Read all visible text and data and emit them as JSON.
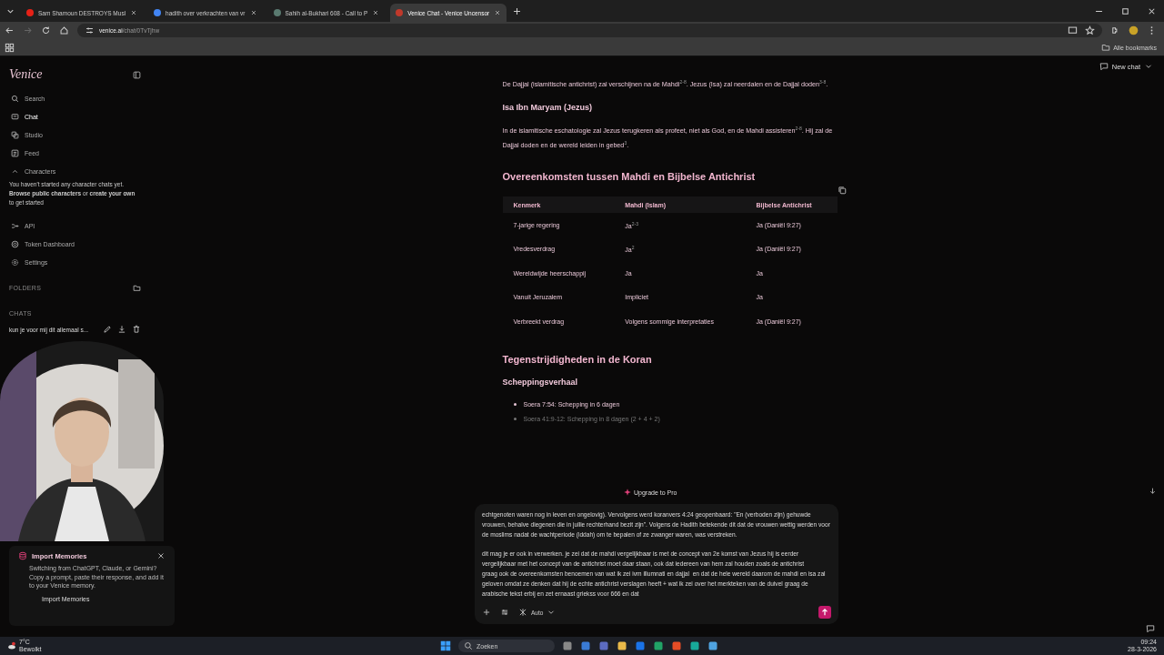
{
  "browser": {
    "tabs": [
      {
        "title": "Sam Shamoun DESTROYS Musl",
        "color": "#e62117",
        "selected": false
      },
      {
        "title": "hadith over verkrachten van vr",
        "color": "#4285f4",
        "selected": false
      },
      {
        "title": "Sahih al-Bukhari 608 - Call to P",
        "color": "#5a7a70",
        "selected": false
      },
      {
        "title": "Venice Chat - Venice Uncensor",
        "color": "#c0392b",
        "selected": true
      }
    ],
    "url_host": "venice.ai",
    "url_path": "/chat/0TvTjhw",
    "bookmarks_label": "Alle bookmarks"
  },
  "sidebar": {
    "logo": "Venice",
    "nav": [
      {
        "kind": "search",
        "label": "Search",
        "selected": false
      },
      {
        "kind": "chat",
        "label": "Chat",
        "selected": true
      },
      {
        "kind": "studio",
        "label": "Studio",
        "selected": false
      },
      {
        "kind": "feed",
        "label": "Feed",
        "selected": false
      }
    ],
    "characters": {
      "label": "Characters",
      "expanded": true,
      "note": "You haven't started any character chats yet. **Browse public characters** or **create your own** to get started"
    },
    "more": [
      {
        "kind": "api",
        "label": "API",
        "selected": false
      },
      {
        "kind": "token",
        "label": "Token Dashboard",
        "selected": false
      },
      {
        "kind": "settings",
        "label": "Settings",
        "selected": false
      }
    ],
    "folders_label": "FOLDERS",
    "chats_label": "CHATS",
    "chats": [
      {
        "title": "kun je voor mij dit allemaal s..."
      }
    ]
  },
  "header": {
    "new_chat": "New chat"
  },
  "content": [
    {
      "kind": "p",
      "text": "De Dajjal (islamitische antichrist) zal verschijnen na de Mahdi$^{2-8}$. Jezus (Isa) zal neerdalen en de Dajjal doden$^{3-8}$."
    },
    {
      "kind": "h3",
      "text": "Isa Ibn Maryam (Jezus)"
    },
    {
      "kind": "p",
      "text": "In de islamitische eschatologie zal Jezus terugkeren als profeet, niet als God, en de Mahdi assisteren$^{2-8}$. Hij zal de Dajjal doden en de wereld leiden in gebed$^{3}$."
    },
    {
      "kind": "h2",
      "text": "Overeenkomsten tussen Mahdi en Bijbelse Antichrist"
    },
    {
      "kind": "table",
      "columns": [
        "Kenmerk",
        "Mahdi (Islam)",
        "Bijbelse Antichrist"
      ],
      "rows": [
        [
          "7-jarige regering",
          "Ja$^{2-3}$",
          "Ja (Daniël 9:27)"
        ],
        [
          "Vredesverdrag",
          "Ja$^{2}$",
          "Ja (Daniël 9:27)"
        ],
        [
          "Wereldwijde heerschappij",
          "Ja",
          "Ja"
        ],
        [
          "Vanuit Jeruzalem",
          "Impliciet",
          "Ja"
        ],
        [
          "Verbreekt verdrag",
          "Volgens sommige interpretaties",
          "Ja (Daniël 9:27)"
        ]
      ]
    },
    {
      "kind": "h2",
      "text": "Tegenstrijdigheden in de Koran"
    },
    {
      "kind": "h3",
      "text": "Scheppingsverhaal"
    },
    {
      "kind": "ul",
      "items": [
        "Soera 7:54: Schepping in 6 dagen",
        "Soera 41:9-12: Schepping in 8 dagen (2 + 4 + 2)"
      ]
    }
  ],
  "upgrade_label": "Upgrade to Pro",
  "composer": {
    "paragraphs": [
      "echtgenoten waren nog in leven en ongelovig). Vervolgens werd koranvers 4:24 geopenbaard: \"En (verboden zijn) gehuwde vrouwen, behalve diegenen die in jullie rechterhand bezit zijn\". Volgens de Hadith betekende dit dat de vrouwen wettig werden voor de moslims nadat de wachtperiode (iddah) om te bepalen of ze zwanger waren, was verstreken.",
      "dit mag je er ook in verwerken. je zei dat de mahdi vergelijkbaar is met de concept van 2e komst van Jezus hij is eerder vergelijkbaar met het concept van de antichrist moet daar staan, ook dat iedereen van hem zal houden zoals de antichrist\ngraag ook de overeenkomsten benoemen van wat ik zei ivm illumnati en dajjal  en dat de hele wereld daarom de mahdi en isa zal geloven omdat ze denken dat hij de echte antichrist verslagen heeft + wat ik zei over het merkteken van de duivel graag de arabische tekst erbij en zet ernaast griekss voor 666 en dat"
    ],
    "model": "Auto"
  },
  "import_card": {
    "title": "Import Memories",
    "text": "Switching from ChatGPT, Claude, or Gemini? Copy a prompt, paste their response, and add it to your Venice memory.",
    "button": "Import Memories"
  },
  "taskbar": {
    "temperature": "7°C",
    "weather": "Bewolkt",
    "search_placeholder": "Zoeken",
    "time": "09:24",
    "date": "28-3-2026"
  }
}
